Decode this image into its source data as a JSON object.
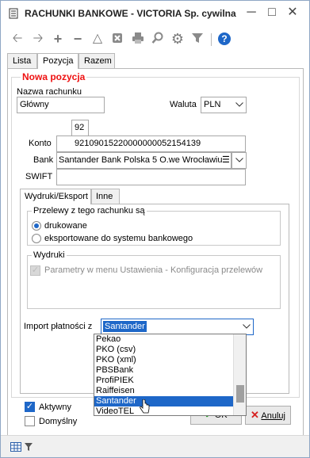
{
  "window": {
    "title": "RACHUNKI BANKOWE - VICTORIA Sp. cywilna",
    "minimize": "─",
    "maximize": "□",
    "close": "✕"
  },
  "toolbar": {
    "icons": [
      "arrow-left-icon",
      "arrow-right-icon",
      "plus-icon",
      "minus-icon",
      "warning-icon",
      "delete-icon",
      "print-icon",
      "search-icon",
      "gear-icon",
      "filter-icon",
      "help-icon"
    ],
    "help_label": "?"
  },
  "tabs": [
    "Lista",
    "Pozycja",
    "Razem"
  ],
  "form": {
    "section_title": "Nowa pozycja",
    "nazwa_label": "Nazwa rachunku",
    "nazwa_value": "Główny",
    "waluta_label": "Waluta",
    "waluta_value": "PLN",
    "bank_code": "92",
    "konto_label": "Konto",
    "konto_value": "92109015220000000052154139",
    "bank_label": "Bank",
    "bank_value": "Santander Bank Polska 5 O.we Wrocławiu",
    "swift_label": "SWIFT",
    "swift_value": ""
  },
  "subtabs": [
    "Wydruki/Eksport",
    "Inne"
  ],
  "przelewy": {
    "title": "Przelewy z tego rachunku są",
    "opt1": "drukowane",
    "opt2": "eksportowane do systemu bankowego"
  },
  "wydruki": {
    "title": "Wydruki",
    "checkbox_label": "Parametry w menu Ustawienia - Konfiguracja przelewów"
  },
  "import": {
    "label": "Import płatności z",
    "value": "Santander",
    "options": [
      "Pekao",
      "PKO (csv)",
      "PKO (xml)",
      "PBSBank",
      "ProfiPIEK",
      "Raiffeisen",
      "Santander",
      "VideoTEL"
    ],
    "selected": "Santander"
  },
  "bottom": {
    "aktywny": "Aktywny",
    "domyslny": "Domyślny",
    "ok": "OK",
    "anuluj": "Anuluj"
  },
  "colors": {
    "accent": "#1e67c8",
    "section_title": "#e11111",
    "cancel_icon": "#d62020",
    "ok_icon": "#2a9a2a"
  }
}
